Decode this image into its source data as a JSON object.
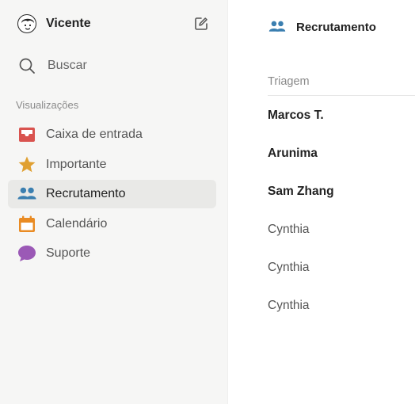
{
  "sidebar": {
    "user": {
      "name": "Vicente",
      "avatar_icon": "avatar-icon",
      "compose_icon": "compose-icon"
    },
    "search": {
      "label": "Buscar",
      "icon": "search-icon"
    },
    "section_title": "Visualizações",
    "items": [
      {
        "label": "Caixa de entrada",
        "icon": "inbox-icon",
        "color": "#d9534f"
      },
      {
        "label": "Importante",
        "icon": "star-icon",
        "color": "#e0a031"
      },
      {
        "label": "Recrutamento",
        "icon": "people-icon",
        "color": "#3b7fb0",
        "active": true
      },
      {
        "label": "Calendário",
        "icon": "calendar-icon",
        "color": "#e98b23"
      },
      {
        "label": "Suporte",
        "icon": "chat-bubble-icon",
        "color": "#9b59b6"
      }
    ]
  },
  "main": {
    "title": "Recrutamento",
    "title_icon": "people-icon",
    "group_header": "Triagem",
    "rows": [
      {
        "name": "Marcos T.",
        "bold": true
      },
      {
        "name": "Arunima",
        "bold": true
      },
      {
        "name": "Sam Zhang",
        "bold": true
      },
      {
        "name": "Cynthia",
        "bold": false
      },
      {
        "name": "Cynthia",
        "bold": false
      },
      {
        "name": "Cynthia",
        "bold": false
      }
    ]
  }
}
